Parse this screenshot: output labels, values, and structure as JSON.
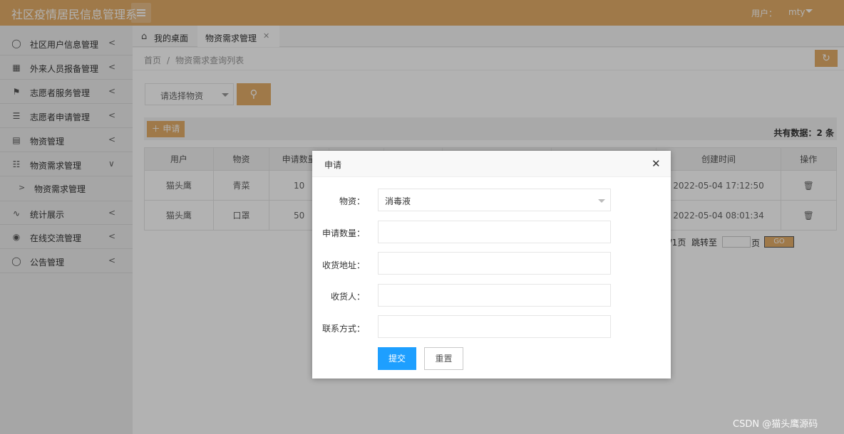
{
  "header": {
    "app_title": "社区疫情居民信息管理系",
    "user_label": "用户：",
    "user_name": "mty"
  },
  "sidebar": {
    "items": [
      {
        "label": "社区用户信息管理"
      },
      {
        "label": "外来人员报备管理"
      },
      {
        "label": "志愿者服务管理"
      },
      {
        "label": "志愿者申请管理"
      },
      {
        "label": "物资管理"
      },
      {
        "label": "物资需求管理"
      },
      {
        "label": "统计展示"
      },
      {
        "label": "在线交流管理"
      },
      {
        "label": "公告管理"
      }
    ],
    "sub_items": [
      {
        "label": "物资需求管理"
      }
    ]
  },
  "tabs": [
    {
      "label": "我的桌面"
    },
    {
      "label": "物资需求管理"
    }
  ],
  "breadcrumb": {
    "home": "首页",
    "current": "物资需求查询列表"
  },
  "filter": {
    "select_placeholder": "请选择物资"
  },
  "toolbar": {
    "apply_label": "申请",
    "total_prefix": "共有数据：",
    "total_count": "2",
    "total_suffix": "条"
  },
  "table": {
    "headers": [
      "用户",
      "物资",
      "申请数量",
      "",
      "",
      "",
      "",
      "创建时间",
      "操作"
    ],
    "rows": [
      {
        "user": "猫头鹰",
        "item": "青菜",
        "qty": "10",
        "created": "2022-05-04 17:12:50"
      },
      {
        "user": "猫头鹰",
        "item": "口罩",
        "qty": "50",
        "created": "2022-05-04 08:01:34"
      }
    ]
  },
  "pager": {
    "page_info": "1/1页",
    "jump_label": "跳转至",
    "page_suffix": "页",
    "go_label": "GO"
  },
  "modal": {
    "title": "申请",
    "fields": [
      {
        "label": "物资：",
        "value": "消毒液"
      },
      {
        "label": "申请数量：",
        "value": ""
      },
      {
        "label": "收货地址：",
        "value": ""
      },
      {
        "label": "收货人：",
        "value": ""
      },
      {
        "label": "联系方式：",
        "value": ""
      }
    ],
    "submit_label": "提交",
    "reset_label": "重置"
  },
  "watermark": "CSDN @猫头鹰源码",
  "colors": {
    "accent": "#e4ae69",
    "primary_button": "#1e9fff"
  }
}
